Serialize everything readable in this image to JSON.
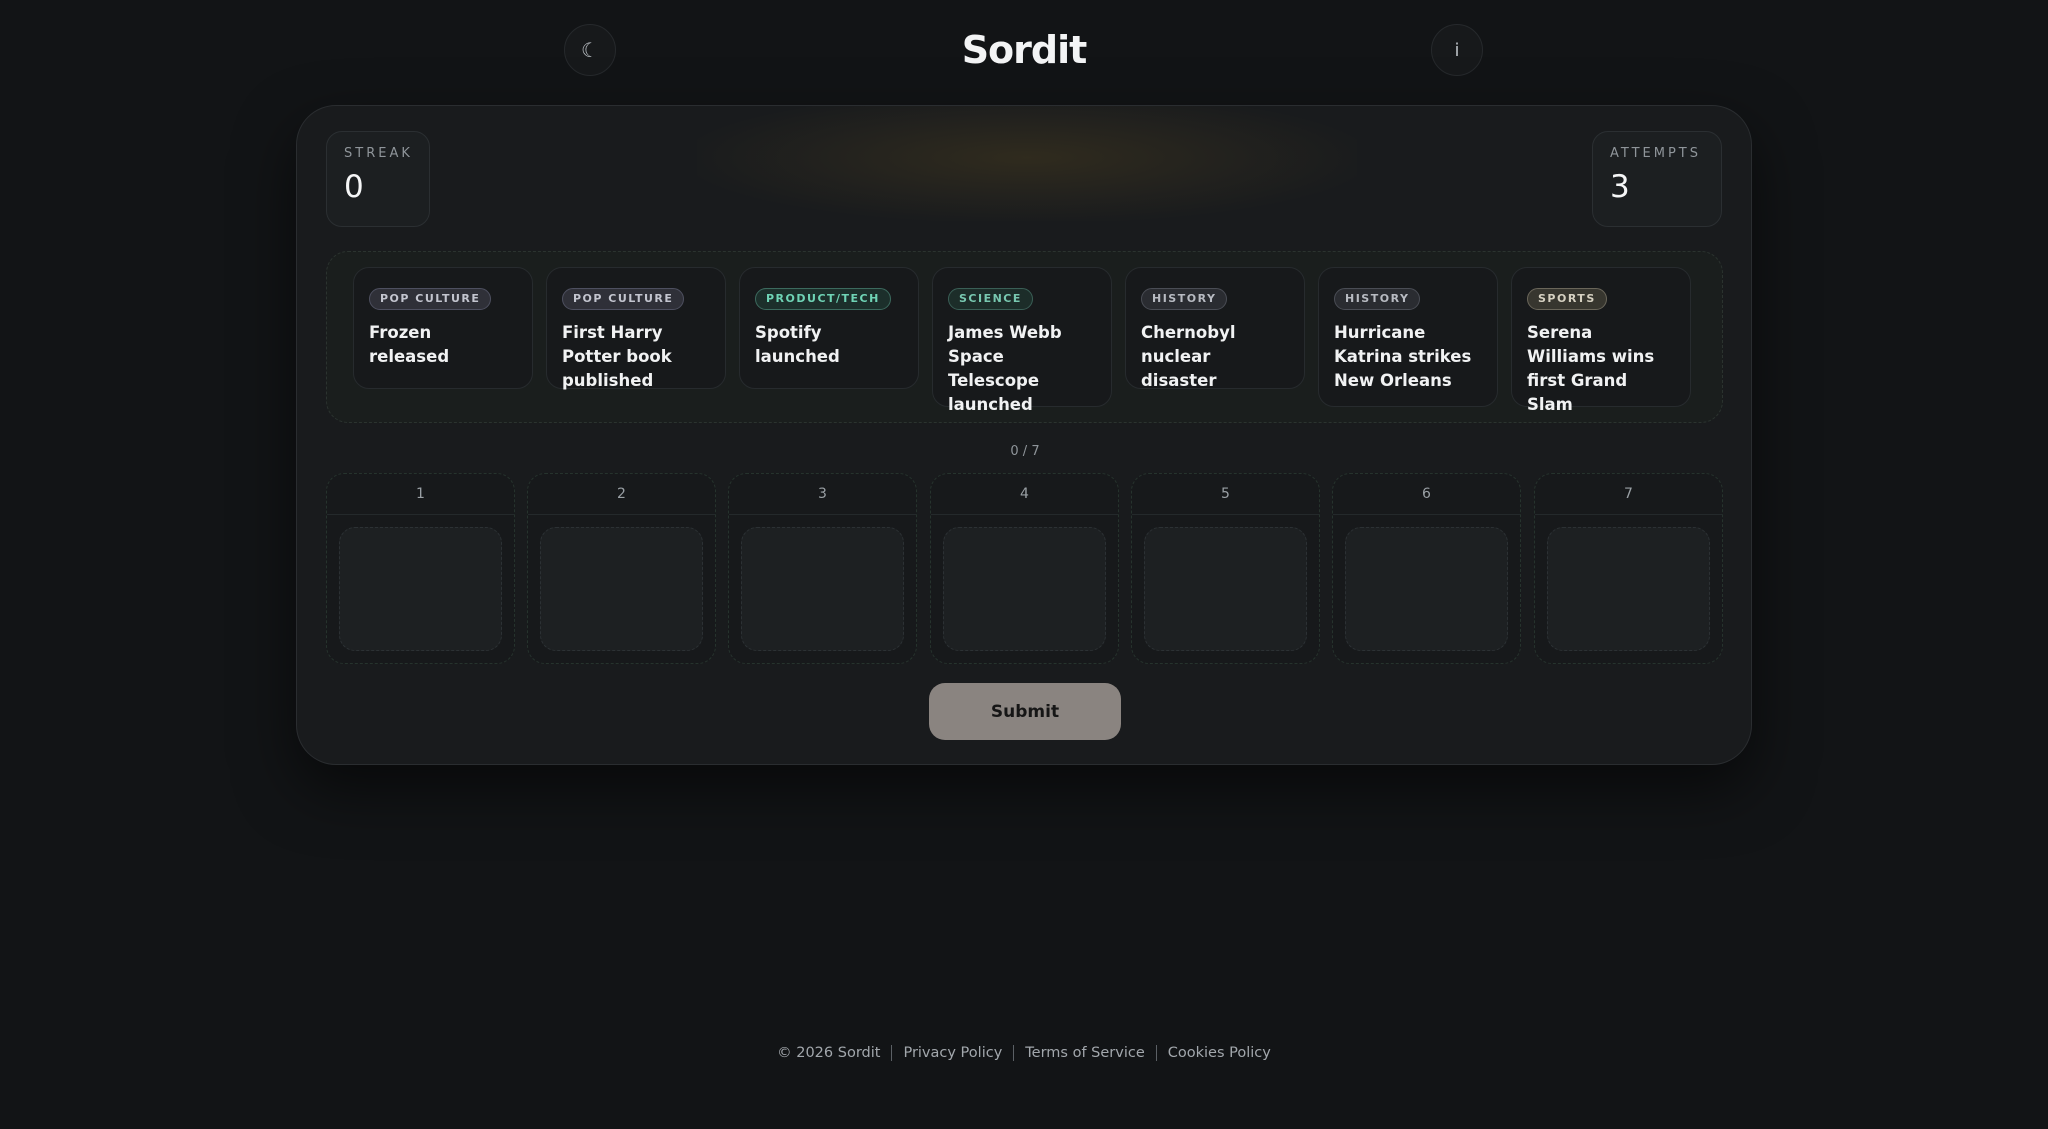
{
  "header": {
    "logo": "Sordit",
    "theme_icon": "☾",
    "info_icon": "i"
  },
  "stats": {
    "streak_label": "STREAK",
    "streak_value": "0",
    "attempts_label": "ATTEMPTS",
    "attempts_value": "3"
  },
  "events": [
    {
      "category": "POP CULTURE",
      "title": "Frozen released"
    },
    {
      "category": "POP CULTURE",
      "title": "First Harry Potter book published"
    },
    {
      "category": "PRODUCT/TECH",
      "title": "Spotify launched"
    },
    {
      "category": "SCIENCE",
      "title": "James Webb Space Telescope launched"
    },
    {
      "category": "HISTORY",
      "title": "Chernobyl nuclear disaster"
    },
    {
      "category": "HISTORY",
      "title": "Hurricane Katrina strikes New Orleans"
    },
    {
      "category": "SPORTS",
      "title": "Serena Williams wins first Grand Slam"
    }
  ],
  "progress": "0 / 7",
  "slots": [
    "1",
    "2",
    "3",
    "4",
    "5",
    "6",
    "7"
  ],
  "submit_label": "Submit",
  "footer": {
    "copyright": "© 2026 Sordit",
    "links": [
      "Privacy Policy",
      "Terms of Service",
      "Cookies Policy"
    ]
  },
  "colors": {
    "background": "#121416",
    "card": "#191b1d",
    "submit": "#8a8480",
    "tech_tag": "#6fd3b5"
  }
}
